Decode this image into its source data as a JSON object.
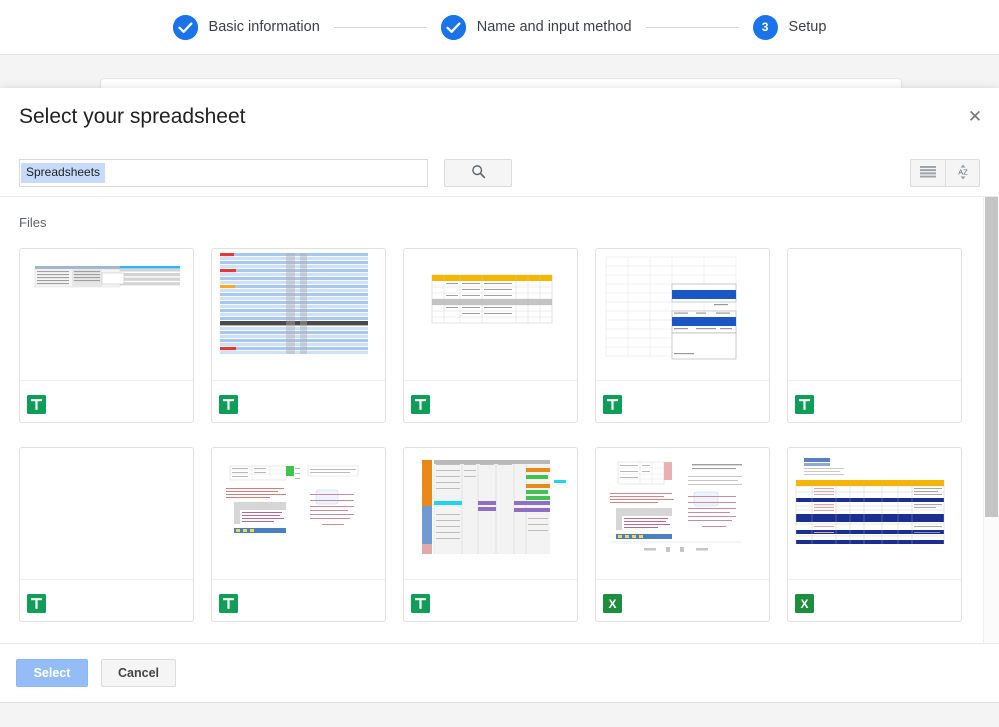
{
  "stepper": {
    "steps": [
      {
        "label": "Basic information",
        "state": "complete",
        "marker": "check"
      },
      {
        "label": "Name and input method",
        "state": "complete",
        "marker": "check"
      },
      {
        "label": "Setup",
        "state": "current",
        "marker": "3"
      }
    ]
  },
  "dialog": {
    "title": "Select your spreadsheet",
    "close_label": "✕"
  },
  "search": {
    "chip": "Spreadsheets",
    "value": "",
    "placeholder": "",
    "button_icon": "search-icon"
  },
  "toolbar": {
    "buttons": [
      {
        "icon": "list-view-icon",
        "label": ""
      },
      {
        "icon": "sort-az-icon",
        "label": ""
      }
    ]
  },
  "files_section": {
    "label": "Files",
    "items": [
      {
        "icon": "google-sheets-icon",
        "thumb": "t1"
      },
      {
        "icon": "google-sheets-icon",
        "thumb": "t2"
      },
      {
        "icon": "google-sheets-icon",
        "thumb": "t3"
      },
      {
        "icon": "google-sheets-icon",
        "thumb": "t4"
      },
      {
        "icon": "google-sheets-icon",
        "thumb": "t5"
      },
      {
        "icon": "google-sheets-icon",
        "thumb": "t6"
      },
      {
        "icon": "google-sheets-icon",
        "thumb": "t7"
      },
      {
        "icon": "google-sheets-icon",
        "thumb": "t8"
      },
      {
        "icon": "microsoft-excel-icon",
        "thumb": "t9"
      },
      {
        "icon": "microsoft-excel-icon",
        "thumb": "t10"
      }
    ]
  },
  "footer": {
    "select_label": "Select",
    "cancel_label": "Cancel"
  },
  "colors": {
    "accent_blue": "#1a73e8",
    "chip_blue": "#c6dafc",
    "sheets_green": "#0f9d58",
    "excel_green": "#1e8e3e",
    "disabled_button": "#94bdf7"
  }
}
